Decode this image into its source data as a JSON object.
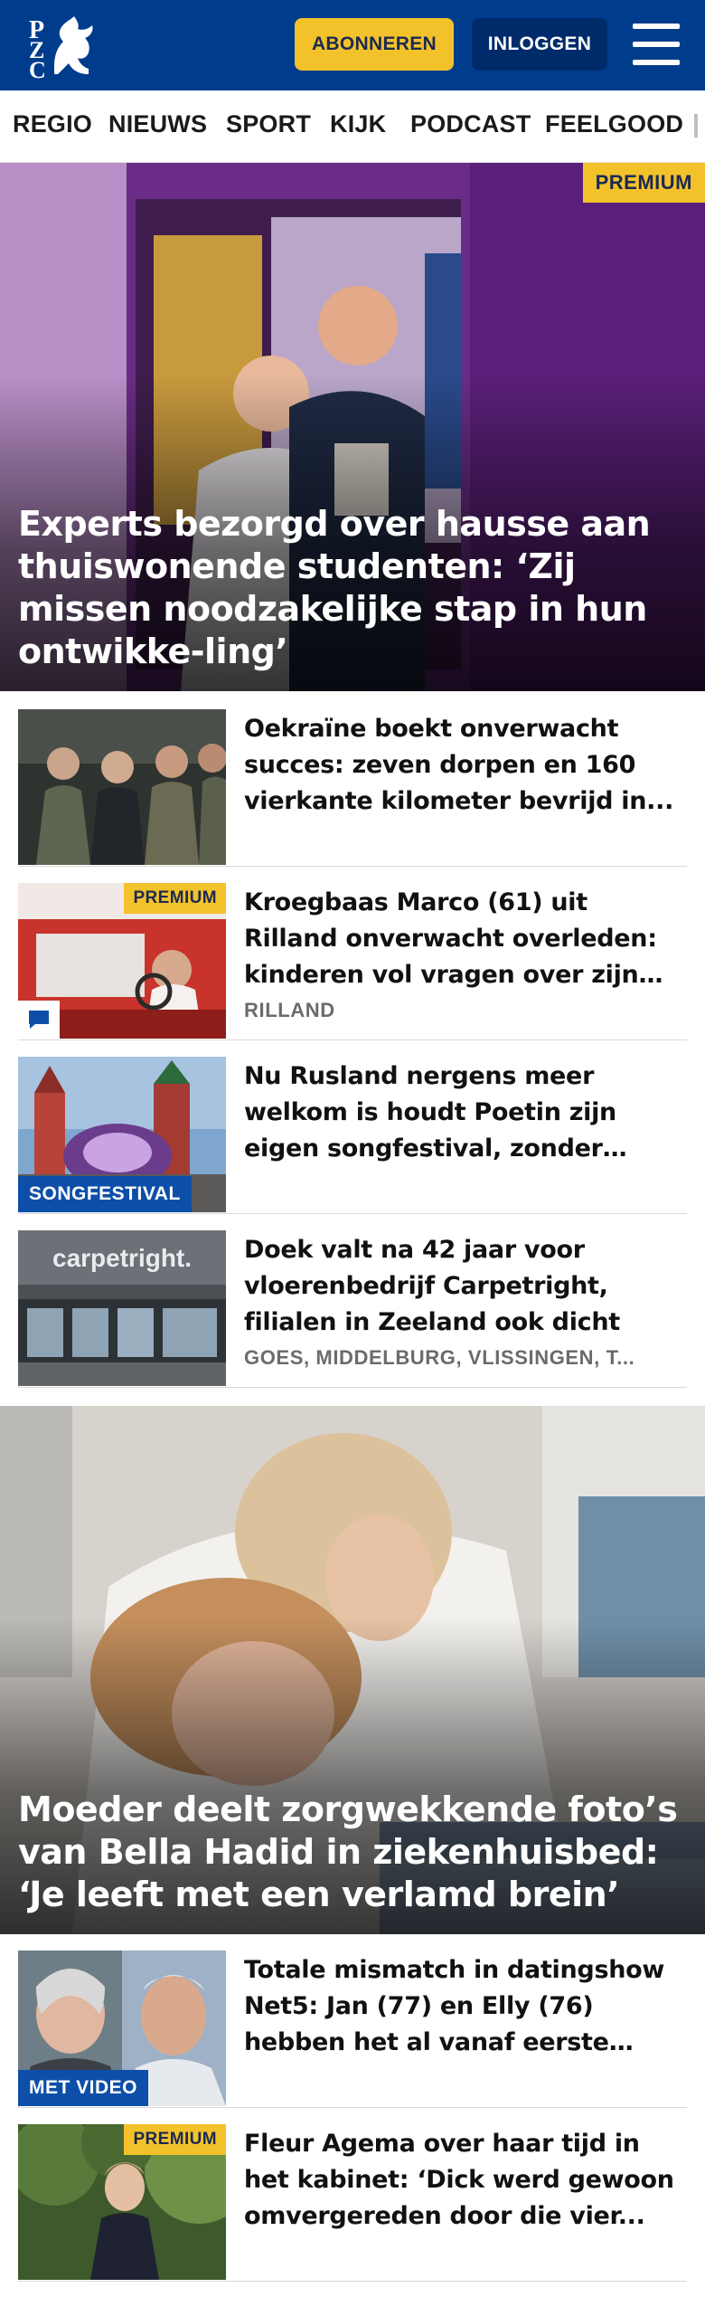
{
  "header": {
    "logo_text": "PZC",
    "subscribe_label": "ABONNEREN",
    "login_label": "INLOGGEN",
    "menu_icon": "hamburger-menu-icon"
  },
  "nav": {
    "items": [
      "REGIO",
      "NIEUWS",
      "SPORT",
      "KIJK",
      "PODCAST",
      "FEELGOOD"
    ]
  },
  "hero1": {
    "badge": "PREMIUM",
    "title": "Experts bezorgd over hausse aan thuiswonende studenten: ‘Zij missen noodzakelijke stap in hun ontwikke-ling’"
  },
  "articles": [
    {
      "title": "Oekraïne boekt onverwacht succes: zeven dorpen en 160 vierkante kilometer bevrijd in...",
      "meta": ""
    },
    {
      "badge": "PREMIUM",
      "title": "Kroegbaas Marco (61) uit Rilland onverwacht overleden: kinderen vol vragen over zijn plotselinge...",
      "meta": "RILLAND",
      "icon": "comment-icon"
    },
    {
      "label": "SONGFESTIVAL",
      "title": "Nu Rusland nergens meer welkom is houdt Poetin zijn eigen songfestival, zonder ‘lhbti-...",
      "meta": ""
    },
    {
      "title": "Doek valt na 42 jaar voor vloerenbedrijf Carpetright, filialen in Zeeland ook dicht",
      "meta": "GOES, MIDDELBURG, VLISSINGEN, T...",
      "thumb_text": "carpetright."
    }
  ],
  "hero2": {
    "title": "Moeder deelt zorgwekkende foto’s van Bella Hadid in ziekenhuisbed: ‘Je leeft met een verlamd brein’"
  },
  "articles2": [
    {
      "label": "MET VIDEO",
      "title": "Totale mismatch in datingshow Net5: Jan (77) en Elly (76) hebben het al vanaf eerste minuut niet ..."
    },
    {
      "badge": "PREMIUM",
      "title": "Fleur Agema over haar tijd in het kabinet: ‘Dick werd gewoon omvergereden door die vier..."
    }
  ],
  "colors": {
    "brand_blue": "#003c8c",
    "premium_yellow": "#f3c22b",
    "label_blue": "#0d4fa8"
  }
}
